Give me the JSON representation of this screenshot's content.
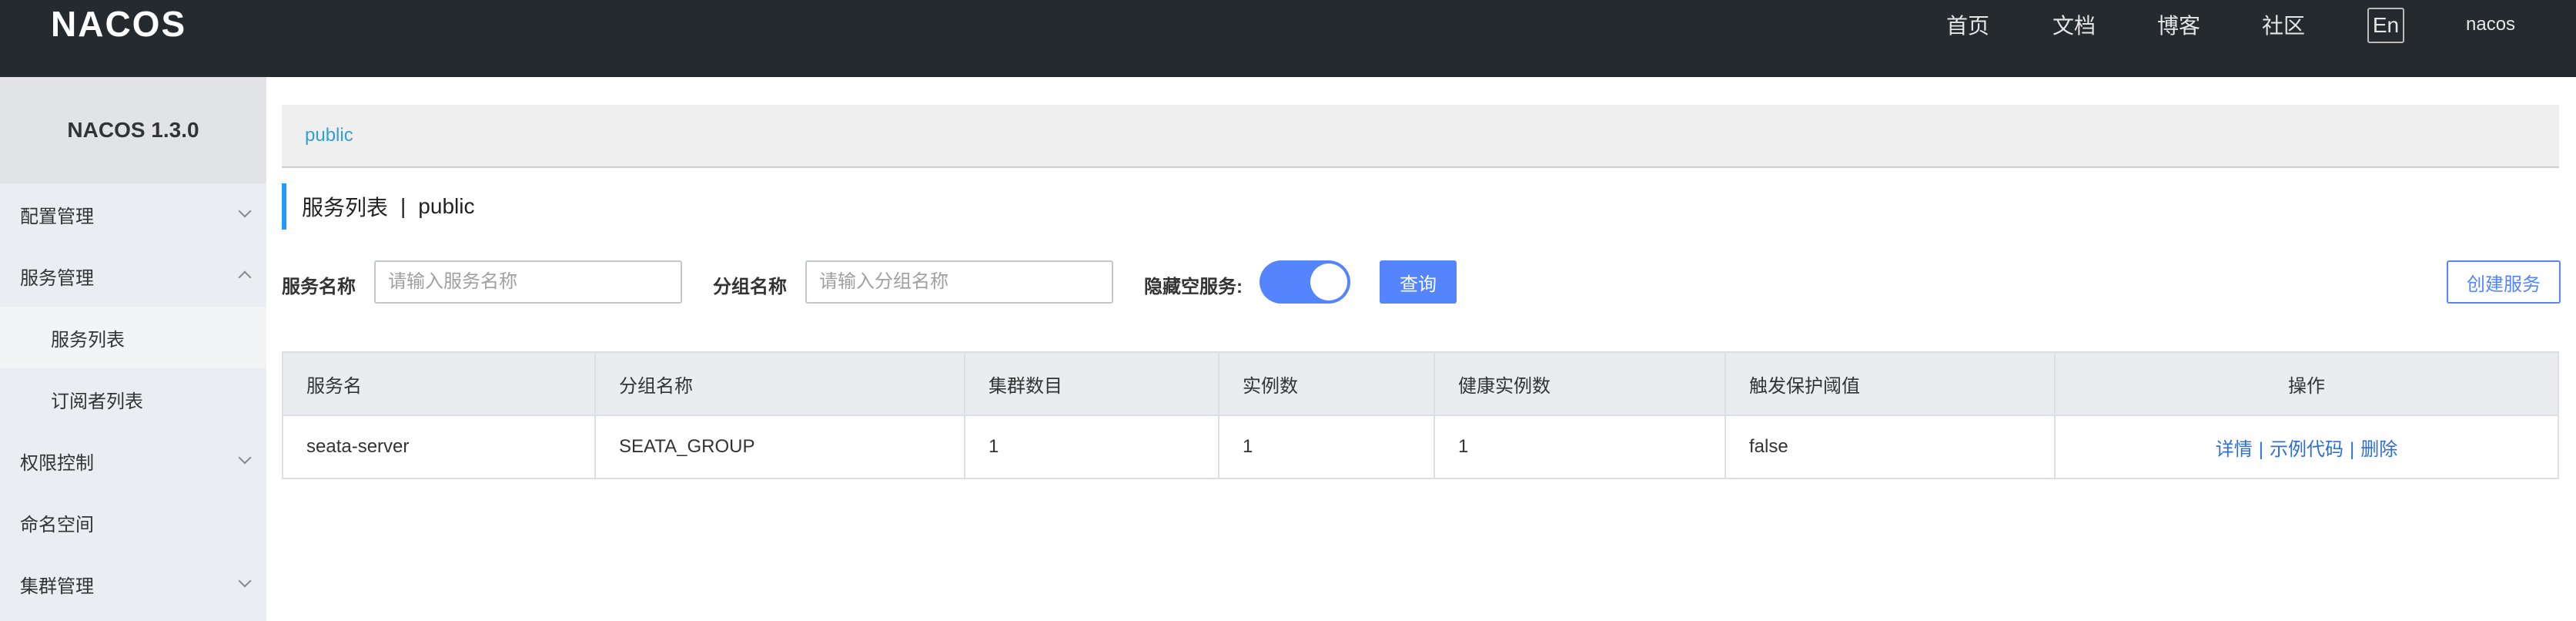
{
  "header": {
    "logo": "NACOS",
    "nav": [
      "首页",
      "文档",
      "博客",
      "社区"
    ],
    "lang": "En",
    "user": "nacos"
  },
  "sidebar": {
    "title": "NACOS 1.3.0",
    "items": [
      {
        "label": "配置管理",
        "chevron": "down"
      },
      {
        "label": "服务管理",
        "chevron": "up"
      },
      {
        "label": "服务列表",
        "sub": true,
        "active": true
      },
      {
        "label": "订阅者列表",
        "sub": true
      },
      {
        "label": "权限控制",
        "chevron": "down"
      },
      {
        "label": "命名空间"
      },
      {
        "label": "集群管理",
        "chevron": "down"
      }
    ]
  },
  "namespace": {
    "current": "public"
  },
  "page": {
    "title": "服务列表",
    "separator": "|",
    "namespace": "public"
  },
  "filters": {
    "service_name_label": "服务名称",
    "service_name_placeholder": "请输入服务名称",
    "group_name_label": "分组名称",
    "group_name_placeholder": "请输入分组名称",
    "hide_empty_label": "隐藏空服务:",
    "hide_empty_on": true,
    "query_button": "查询",
    "create_button": "创建服务"
  },
  "table": {
    "columns": [
      "服务名",
      "分组名称",
      "集群数目",
      "实例数",
      "健康实例数",
      "触发保护阈值",
      "操作"
    ],
    "rows": [
      {
        "service": "seata-server",
        "group": "SEATA_GROUP",
        "clusters": "1",
        "instances": "1",
        "healthy": "1",
        "protect": "false",
        "actions": [
          "详情",
          "示例代码",
          "删除"
        ],
        "action_sep": "|"
      }
    ]
  },
  "colors": {
    "header_bg": "#252a2f",
    "primary": "#5584ff",
    "link": "#2d6fd6",
    "accent": "#209bfa"
  }
}
